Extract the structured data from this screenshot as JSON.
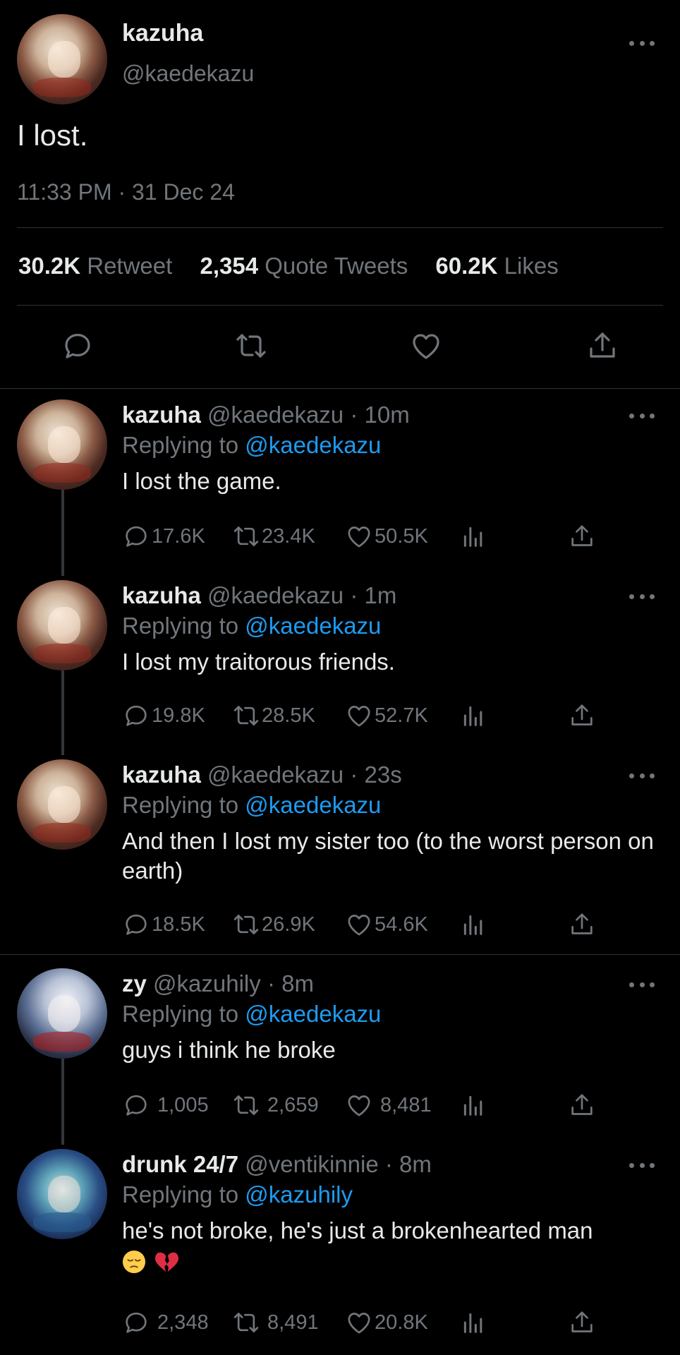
{
  "main_tweet": {
    "display_name": "kazuha",
    "handle": "@kaedekazu",
    "text": "I lost.",
    "timestamp": "11:33 PM · 31 Dec 24",
    "stats": {
      "retweets": "30.2K",
      "retweets_label": "Retweet",
      "quotes": "2,354",
      "quotes_label": "Quote Tweets",
      "likes": "60.2K",
      "likes_label": "Likes"
    }
  },
  "replies": [
    {
      "display_name": "kazuha",
      "handle": "@kaedekazu",
      "time": "· 10m",
      "replying_prefix": "Replying to",
      "replying_to": "@kaedekazu",
      "text": "I lost the game.",
      "counts": {
        "reply": "17.6K",
        "retweet": "23.4K",
        "like": "50.5K"
      }
    },
    {
      "display_name": "kazuha",
      "handle": "@kaedekazu",
      "time": "· 1m",
      "replying_prefix": "Replying to",
      "replying_to": "@kaedekazu",
      "text": "I lost my traitorous friends.",
      "counts": {
        "reply": "19.8K",
        "retweet": "28.5K",
        "like": "52.7K"
      }
    },
    {
      "display_name": "kazuha",
      "handle": "@kaedekazu",
      "time": "· 23s",
      "replying_prefix": "Replying to",
      "replying_to": "@kaedekazu",
      "text": "And then I lost my sister too (to the worst person on earth)",
      "counts": {
        "reply": "18.5K",
        "retweet": "26.9K",
        "like": "54.6K"
      }
    },
    {
      "display_name": "zy",
      "handle": "@kazuhily",
      "time": "· 8m",
      "replying_prefix": "Replying to",
      "replying_to": "@kaedekazu",
      "text": "guys i think he broke",
      "counts": {
        "reply": "1,005",
        "retweet": "2,659",
        "like": "8,481"
      }
    },
    {
      "display_name": "drunk 24/7",
      "handle": "@ventikinnie",
      "time": "· 8m",
      "replying_prefix": "Replying to",
      "replying_to": "@kazuhily",
      "text": "he's not broke, he's just a brokenhearted man",
      "emojis": [
        "pensive-face-emoji",
        "broken-heart-emoji"
      ],
      "counts": {
        "reply": "2,348",
        "retweet": "8,491",
        "like": "20.8K"
      }
    }
  ],
  "icons": [
    "more-icon",
    "reply-icon",
    "retweet-icon",
    "like-icon",
    "share-icon",
    "views-icon"
  ],
  "colors": {
    "background": "#000000",
    "text": "#e7e9ea",
    "muted": "#71767b",
    "link": "#1d9bf0",
    "divider": "#2f3336"
  }
}
